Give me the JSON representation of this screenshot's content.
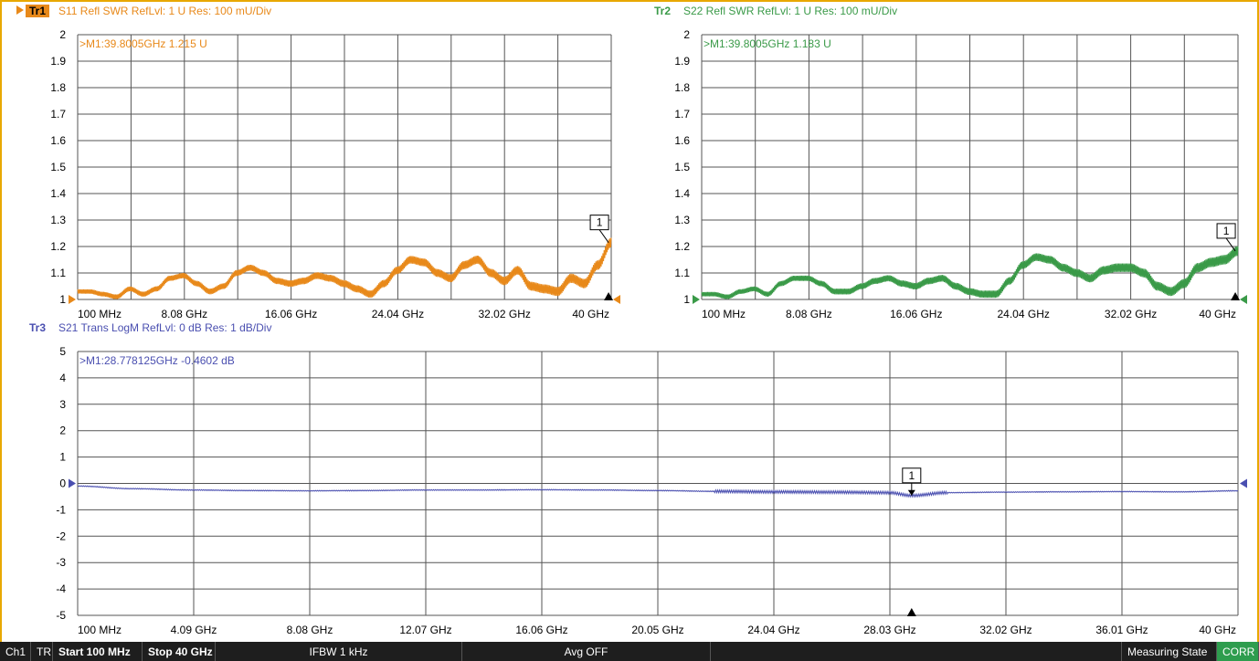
{
  "chart_data": [
    {
      "id": "tr1",
      "type": "line",
      "trace_label": "Tr1",
      "header": "S11 Refl SWR RefLvl: 1  U Res: 100 mU/Div",
      "marker_readout": ">M1:39.8005GHz  1.215  U",
      "marker_label": "1",
      "color": "#e8891a",
      "ylim": [
        1,
        2
      ],
      "yticks": [
        "2",
        "1.9",
        "1.8",
        "1.7",
        "1.6",
        "1.5",
        "1.4",
        "1.3",
        "1.2",
        "1.1",
        "1"
      ],
      "xlim": [
        0.1,
        40
      ],
      "xticks": [
        "100 MHz",
        "8.08 GHz",
        "16.06 GHz",
        "24.04 GHz",
        "32.02 GHz",
        "40 GHz"
      ],
      "marker": {
        "x": 39.8005,
        "y": 1.215
      },
      "x": [
        0.1,
        1,
        2,
        3,
        4,
        5,
        6,
        7,
        8,
        9,
        10,
        11,
        12,
        13,
        14,
        15,
        16,
        17,
        18,
        19,
        20,
        21,
        22,
        23,
        24,
        25,
        26,
        27,
        28,
        29,
        30,
        31,
        32,
        33,
        34,
        35,
        36,
        37,
        38,
        39,
        40
      ],
      "y": [
        1.03,
        1.03,
        1.02,
        1.01,
        1.04,
        1.02,
        1.04,
        1.08,
        1.09,
        1.06,
        1.03,
        1.05,
        1.1,
        1.12,
        1.1,
        1.07,
        1.06,
        1.07,
        1.09,
        1.08,
        1.06,
        1.04,
        1.02,
        1.06,
        1.11,
        1.15,
        1.14,
        1.1,
        1.08,
        1.13,
        1.15,
        1.1,
        1.07,
        1.11,
        1.05,
        1.04,
        1.03,
        1.08,
        1.06,
        1.13,
        1.215
      ]
    },
    {
      "id": "tr2",
      "type": "line",
      "trace_label": "Tr2",
      "header": "S22 Refl SWR RefLvl: 1  U Res: 100 mU/Div",
      "marker_readout": ">M1:39.8005GHz  1.183  U",
      "marker_label": "1",
      "color": "#3a9a48",
      "ylim": [
        1,
        2
      ],
      "yticks": [
        "2",
        "1.9",
        "1.8",
        "1.7",
        "1.6",
        "1.5",
        "1.4",
        "1.3",
        "1.2",
        "1.1",
        "1"
      ],
      "xlim": [
        0.1,
        40
      ],
      "xticks": [
        "100 MHz",
        "8.08 GHz",
        "16.06 GHz",
        "24.04 GHz",
        "32.02 GHz",
        "40 GHz"
      ],
      "marker": {
        "x": 39.8005,
        "y": 1.183
      },
      "x": [
        0.1,
        1,
        2,
        3,
        4,
        5,
        6,
        7,
        8,
        9,
        10,
        11,
        12,
        13,
        14,
        15,
        16,
        17,
        18,
        19,
        20,
        21,
        22,
        23,
        24,
        25,
        26,
        27,
        28,
        29,
        30,
        31,
        32,
        33,
        34,
        35,
        36,
        37,
        38,
        39,
        40
      ],
      "y": [
        1.02,
        1.02,
        1.01,
        1.03,
        1.04,
        1.02,
        1.06,
        1.08,
        1.08,
        1.06,
        1.03,
        1.03,
        1.05,
        1.07,
        1.08,
        1.06,
        1.05,
        1.07,
        1.08,
        1.05,
        1.03,
        1.02,
        1.02,
        1.07,
        1.13,
        1.16,
        1.15,
        1.12,
        1.1,
        1.08,
        1.11,
        1.12,
        1.12,
        1.1,
        1.05,
        1.03,
        1.06,
        1.12,
        1.14,
        1.15,
        1.183
      ]
    },
    {
      "id": "tr3",
      "type": "line",
      "trace_label": "Tr3",
      "header": "S21 Trans LogM RefLvl: 0  dB Res: 1  dB/Div",
      "marker_readout": ">M1:28.778125GHz  -0.4602  dB",
      "marker_label": "1",
      "color": "#4a4fb0",
      "ylim": [
        -5,
        5
      ],
      "yticks": [
        "5",
        "4",
        "3",
        "2",
        "1",
        "0",
        "-1",
        "-2",
        "-3",
        "-4",
        "-5"
      ],
      "xlim": [
        0.1,
        40
      ],
      "xticks": [
        "100 MHz",
        "4.09 GHz",
        "8.08 GHz",
        "12.07 GHz",
        "16.06 GHz",
        "20.05 GHz",
        "24.04 GHz",
        "28.03 GHz",
        "32.02 GHz",
        "36.01 GHz",
        "40 GHz"
      ],
      "marker": {
        "x": 28.778125,
        "y": -0.4602
      },
      "x": [
        0.1,
        2,
        4,
        6,
        8,
        10,
        12,
        14,
        16,
        18,
        20,
        22,
        24,
        26,
        28,
        28.78,
        30,
        32,
        34,
        36,
        38,
        40
      ],
      "y": [
        -0.1,
        -0.2,
        -0.25,
        -0.27,
        -0.28,
        -0.27,
        -0.25,
        -0.25,
        -0.24,
        -0.25,
        -0.27,
        -0.3,
        -0.32,
        -0.33,
        -0.35,
        -0.46,
        -0.35,
        -0.33,
        -0.32,
        -0.31,
        -0.32,
        -0.28
      ]
    }
  ],
  "status": {
    "channel": "Ch1",
    "mode": "TR",
    "start": "Start 100 MHz",
    "stop": "Stop 40 GHz",
    "ifbw": "IFBW 1 kHz",
    "avg": "Avg OFF",
    "state": "Measuring State",
    "corr": "CORR"
  }
}
